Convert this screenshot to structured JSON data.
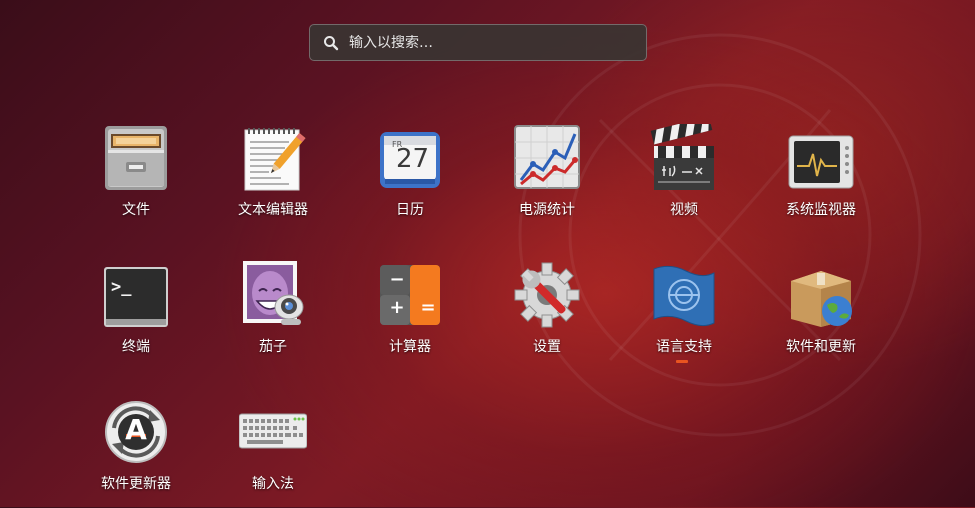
{
  "search": {
    "placeholder": "输入以搜索…"
  },
  "apps": [
    {
      "label": "文件",
      "icon": "file-cabinet-icon"
    },
    {
      "label": "文本编辑器",
      "icon": "text-editor-icon"
    },
    {
      "label": "日历",
      "icon": "calendar-icon",
      "day_abbr": "FR",
      "day_number": "27"
    },
    {
      "label": "电源统计",
      "icon": "power-statistics-icon"
    },
    {
      "label": "视频",
      "icon": "clapperboard-icon"
    },
    {
      "label": "系统监视器",
      "icon": "system-monitor-icon"
    },
    {
      "label": "终端",
      "icon": "terminal-icon",
      "prompt": ">_"
    },
    {
      "label": "茄子",
      "icon": "cheese-webcam-icon"
    },
    {
      "label": "计算器",
      "icon": "calculator-icon",
      "keys": [
        "−",
        "=",
        "+",
        "="
      ]
    },
    {
      "label": "设置",
      "icon": "settings-gear-wrench-icon"
    },
    {
      "label": "语言支持",
      "icon": "language-flag-icon",
      "running": true
    },
    {
      "label": "软件和更新",
      "icon": "software-package-globe-icon"
    },
    {
      "label": "软件更新器",
      "icon": "software-updater-icon",
      "glyph": "A"
    },
    {
      "label": "输入法",
      "icon": "keyboard-icon"
    }
  ],
  "colors": {
    "accent": "#e95420",
    "text": "#ffffff"
  }
}
